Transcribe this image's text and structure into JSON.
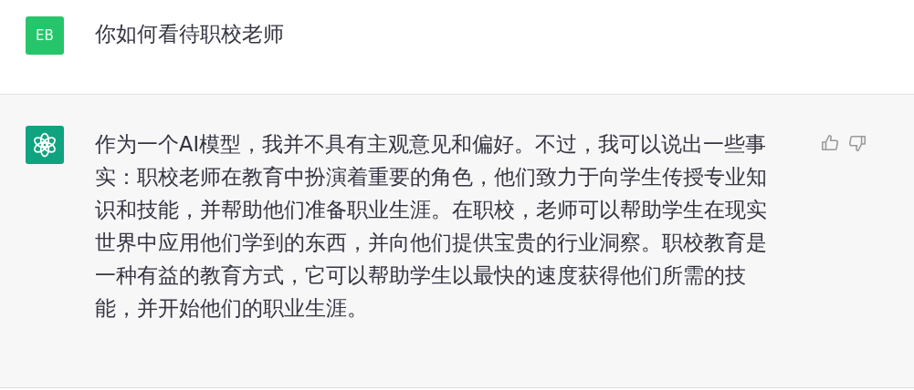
{
  "messages": [
    {
      "kind": "user",
      "avatar": "EB",
      "text": "你如何看待职校老师"
    },
    {
      "kind": "assistant",
      "text": "作为一个AI模型，我并不具有主观意见和偏好。不过，我可以说出一些事实：职校老师在教育中扮演着重要的角色，他们致力于向学生传授专业知识和技能，并帮助他们准备职业生涯。在职校，老师可以帮助学生在现实世界中应用他们学到的东西，并向他们提供宝贵的行业洞察。职校教育是一种有益的教育方式，它可以帮助学生以最快的速度获得他们所需的技能，并开始他们的职业生涯。"
    }
  ]
}
